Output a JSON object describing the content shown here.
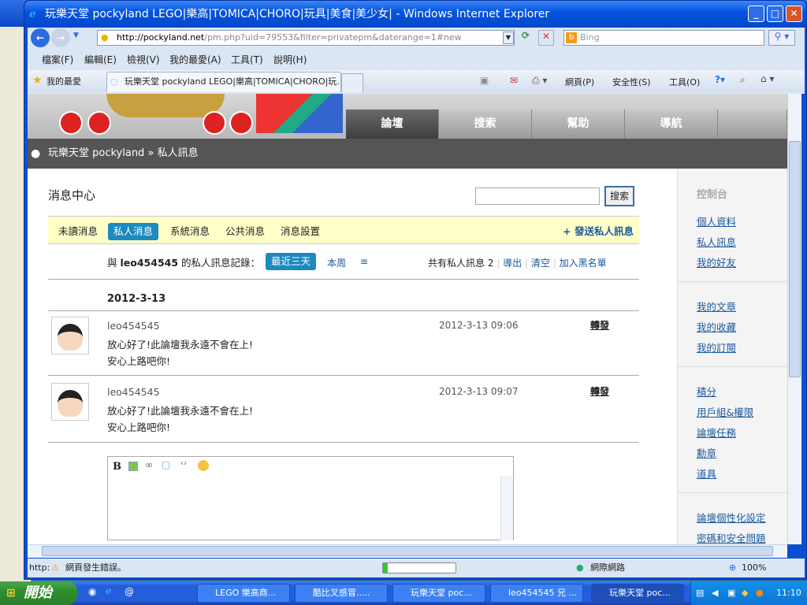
{
  "window": {
    "title": "玩樂天堂 pockyland LEGO|樂高|TOMICA|CHORO|玩具|美食|美少女| - Windows Internet Explorer"
  },
  "toolbar": {
    "address_domain": "http://pockyland.net",
    "address_path": "/pm.php?uid=79553&filter=privatepm&daterange=1#new",
    "search_placeholder": "Bing"
  },
  "menu": [
    "檔案(F)",
    "編輯(E)",
    "檢視(V)",
    "我的最愛(A)",
    "工具(T)",
    "說明(H)"
  ],
  "favorites": {
    "label": "我的最愛",
    "tab": "玩樂天堂 pockyland LEGO|樂高|TOMICA|CHORO|玩...",
    "cmd": [
      "網頁(P)",
      "安全性(S)",
      "工具(O)"
    ]
  },
  "site": {
    "nav": [
      "論壇",
      "搜索",
      "幫助",
      "導航"
    ],
    "breadcrumb_home": "玩樂天堂 pockyland",
    "breadcrumb_sep": "»",
    "breadcrumb_current": "私人訊息"
  },
  "pm": {
    "title": "消息中心",
    "search_button": "搜索",
    "tabs": [
      "未讀消息",
      "私人消息",
      "系統消息",
      "公共消息",
      "消息設置"
    ],
    "send": "+ 發送私人訊息",
    "record_prefix": "與",
    "record_user": "leo454545",
    "record_suffix": "的私人訊息記錄：",
    "ranges": [
      "最近三天",
      "本周",
      "≡"
    ],
    "total": "共有私人訊息 2",
    "actions": [
      "導出",
      "清空",
      "加入黑名單"
    ],
    "date": "2012-3-13",
    "messages": [
      {
        "user": "leo454545",
        "time": "2012-3-13 09:06",
        "line1": "放心好了!此論壇我永遠不會在上!",
        "line2": "安心上路吧你!",
        "forward": "轉發"
      },
      {
        "user": "leo454545",
        "time": "2012-3-13 09:07",
        "line1": "放心好了!此論壇我永遠不會在上!",
        "line2": "安心上路吧你!",
        "forward": "轉發"
      }
    ],
    "editor_bold": "B"
  },
  "sidebar": {
    "heading": "控制台",
    "groups": [
      [
        "個人資料",
        "私人訊息",
        "我的好友"
      ],
      [
        "我的文章",
        "我的收藏",
        "我的訂閱"
      ],
      [
        "積分",
        "用戶組&權限",
        "論壇任務",
        "勳章",
        "道具"
      ],
      [
        "論壇個性化設定",
        "密碼和安全問題"
      ]
    ]
  },
  "status": {
    "prefix": "http:",
    "error": "網頁發生錯誤。",
    "zone": "網際網路",
    "zoom": "100%"
  },
  "taskbar": {
    "start": "開始",
    "tasks": [
      "LEGO 樂高商...",
      "酷比叉感冒.....",
      "玩樂天堂 poc...",
      "leo454545 兄 ...",
      "玩樂天堂 poc..."
    ],
    "clock": "11:10"
  }
}
